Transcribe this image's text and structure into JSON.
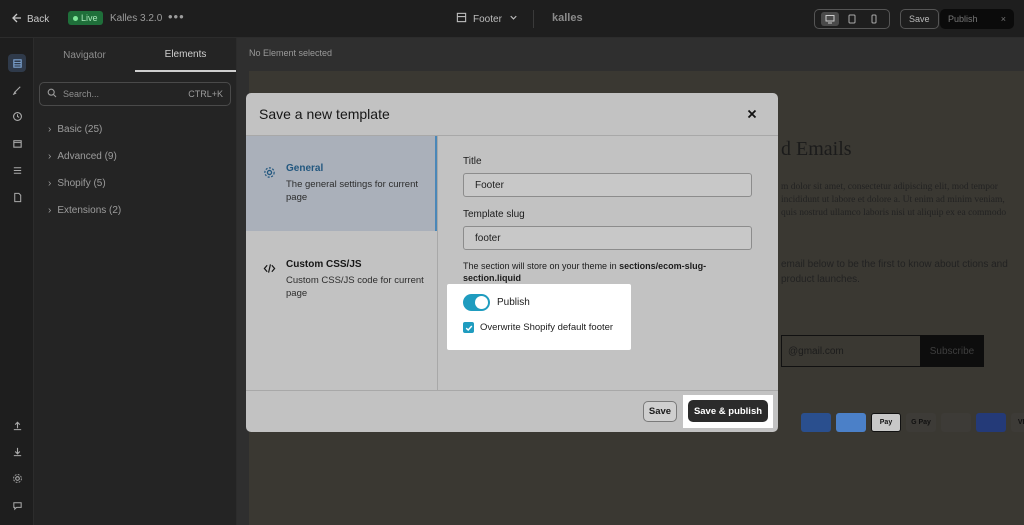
{
  "topbar": {
    "back_label": "Back",
    "live_label": "Live",
    "version": "Kalles 3.2.0",
    "more": "•••",
    "page_name": "Footer",
    "logo_text": "kalles",
    "save_label": "Save",
    "publish_label": "Publish"
  },
  "panel": {
    "tabs": [
      "Navigator",
      "Elements"
    ],
    "active_tab": "Elements",
    "search_placeholder": "Search...",
    "search_shortcut": "CTRL+K",
    "groups": [
      "Basic (25)",
      "Advanced (9)",
      "Shopify (5)",
      "Extensions (2)"
    ]
  },
  "canvas": {
    "header": "No Element selected",
    "preview": {
      "title": "d Emails",
      "body": "m dolor sit amet, consectetur adipiscing elit, mod tempor incididunt ut labore et dolore a. Ut enim ad minim veniam, quis nostrud ullamco laboris nisi ut aliquip ex ea commodo",
      "sub": "email below to be the first to know about ctions and product launches.",
      "email_value": "@gmail.com",
      "subscribe_label": "Subscribe",
      "payments": [
        "",
        "",
        "Pay",
        "G Pay",
        "",
        "",
        "VISA"
      ]
    }
  },
  "modal": {
    "title": "Save a new template",
    "nav": [
      {
        "title": "General",
        "desc": "The general settings for current page",
        "active": true
      },
      {
        "title": "Custom CSS/JS",
        "desc": "Custom CSS/JS code for current page",
        "active": false
      }
    ],
    "form": {
      "title_label": "Title",
      "title_value": "Footer",
      "slug_label": "Template slug",
      "slug_value": "footer",
      "note_prefix": "The section will store on your theme in ",
      "note_path": "sections/ecom-slug-section.liquid"
    },
    "publish_toggle": {
      "label": "Publish",
      "on": true
    },
    "overwrite_checkbox": {
      "label": "Overwrite Shopify default footer",
      "checked": true
    },
    "buttons": {
      "save": "Save",
      "save_publish": "Save & publish"
    }
  },
  "colors": {
    "accent": "#1f9cbf",
    "live_badge": "#1f6f3a",
    "primary_button": "#2b2b2b"
  }
}
